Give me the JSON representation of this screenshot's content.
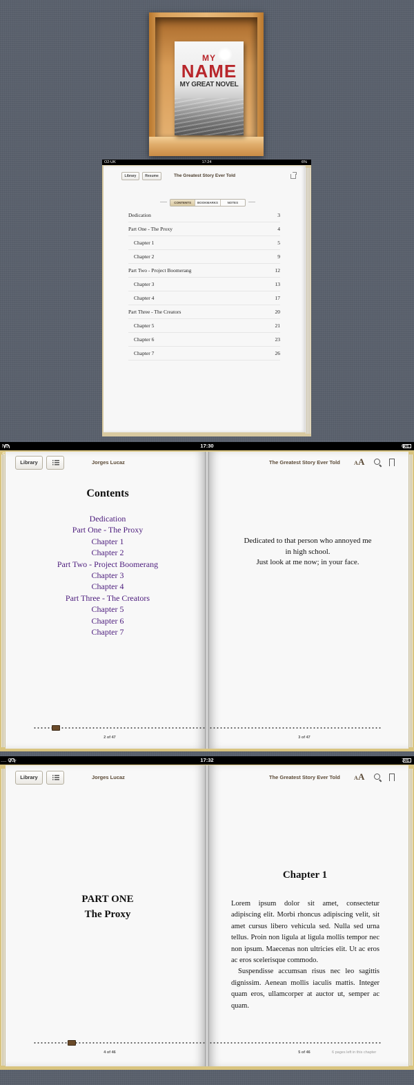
{
  "bookshelf": {
    "cover": {
      "line1": "MY",
      "line2": "NAME",
      "line3": "MY GREAT NOVEL"
    }
  },
  "small_ipad": {
    "status": {
      "carrier": "O2-UK",
      "time": "17:24",
      "battery": "6%"
    },
    "library_label": "Library",
    "resume_label": "Resume",
    "title": "The Greatest Story Ever Told",
    "share_icon": "share-icon",
    "tabs": [
      {
        "label": "CONTENTS",
        "active": true
      },
      {
        "label": "BOOKMARKS",
        "active": false
      },
      {
        "label": "NOTES",
        "active": false
      }
    ],
    "toc": [
      {
        "label": "Dedication",
        "page": "3",
        "indent": false
      },
      {
        "label": "Part One - The Proxy",
        "page": "4",
        "indent": false
      },
      {
        "label": "Chapter 1",
        "page": "5",
        "indent": true
      },
      {
        "label": "Chapter 2",
        "page": "9",
        "indent": true
      },
      {
        "label": "Part Two - Project Boomerang",
        "page": "12",
        "indent": false
      },
      {
        "label": "Chapter 3",
        "page": "13",
        "indent": true
      },
      {
        "label": "Chapter 4",
        "page": "17",
        "indent": true
      },
      {
        "label": "Part Three - The Creators",
        "page": "20",
        "indent": false
      },
      {
        "label": "Chapter 5",
        "page": "21",
        "indent": true
      },
      {
        "label": "Chapter 6",
        "page": "23",
        "indent": true
      },
      {
        "label": "Chapter 7",
        "page": "26",
        "indent": true
      }
    ]
  },
  "spread1": {
    "status": {
      "carrier": "No Service",
      "time": "17:30",
      "battery": "6%"
    },
    "library_label": "Library",
    "author": "Jorges Lucaz",
    "title": "The Greatest Story Ever Told",
    "font_size_label_small": "A",
    "font_size_label_large": "A",
    "toc_heading": "Contents",
    "toc_links": [
      "Dedication",
      "Part One - The Proxy",
      "Chapter 1",
      "Chapter 2",
      "Part Two - Project Boomerang",
      "Chapter 3",
      "Chapter 4",
      "Part Three - The Creators",
      "Chapter 5",
      "Chapter 6",
      "Chapter 7"
    ],
    "dedication_lines": [
      "Dedicated to that person who annoyed me",
      "in high school.",
      "Just look at me now; in your face."
    ],
    "left_page_number": "2 of 47",
    "right_page_number": "3 of 47"
  },
  "spread2": {
    "status": {
      "carrier": "O2-UK",
      "time": "17:32",
      "battery": "7%"
    },
    "library_label": "Library",
    "author": "Jorges Lucaz",
    "title": "The Greatest Story Ever Told",
    "font_size_label_small": "A",
    "font_size_label_large": "A",
    "part_line1": "PART ONE",
    "part_line2": "The Proxy",
    "chapter_title": "Chapter 1",
    "paragraphs": [
      "Lorem ipsum dolor sit amet, consectetur adipiscing elit. Morbi rhoncus adipiscing velit, sit amet cursus libero vehicula sed. Nulla sed urna tellus. Proin non ligula at ligula mollis tempor nec non ipsum. Maecenas non ultricies elit. Ut ac eros ac eros scelerisque commodo.",
      "Suspendisse accumsan risus nec leo sagittis dignissim. Aenean mollis iaculis mattis. Integer quam eros, ullamcorper at auctor ut, semper ac quam."
    ],
    "left_page_number": "4 of 46",
    "right_page_number": "5 of 46",
    "pages_left": "6 pages left in this chapter"
  }
}
